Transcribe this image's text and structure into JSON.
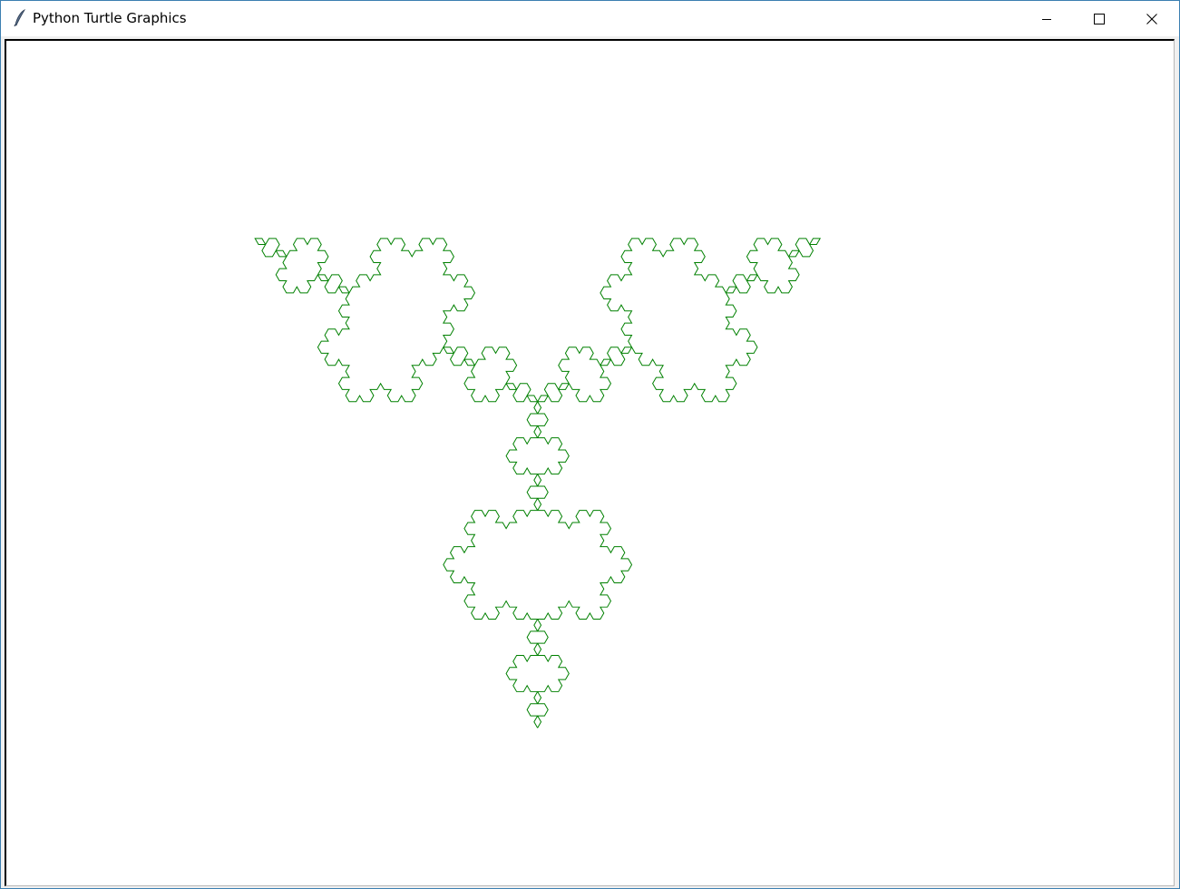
{
  "window": {
    "title": "Python Turtle Graphics",
    "icon": "feather-icon",
    "controls": {
      "minimize": "minimize-icon",
      "maximize": "maximize-icon",
      "close": "close-icon"
    }
  },
  "canvas": {
    "background": "#ffffff",
    "drawing": {
      "shape": "koch-snowflake",
      "pen_color": "#008000",
      "recursion_depth": 4,
      "pen_width": 1
    }
  }
}
